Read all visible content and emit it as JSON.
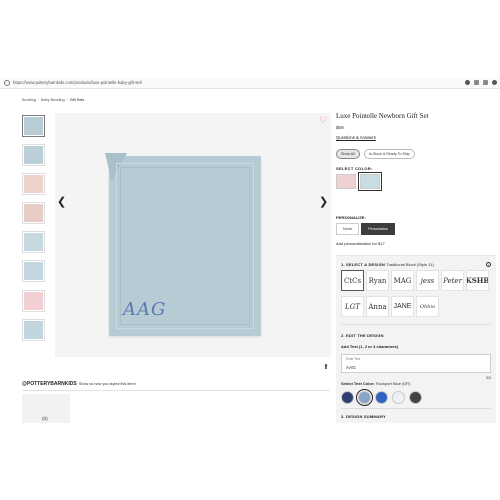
{
  "browser": {
    "url": "https://www.potterybarnkids.com/products/luxe-pointelle-baby-gift-set/"
  },
  "breadcrumb": [
    "Bedding",
    "Baby Bedding",
    "Gift Sets"
  ],
  "product": {
    "title": "Luxe Pointelle Newborn Gift Set",
    "price": "$69",
    "qa_link": "Questions & Answers",
    "filters": [
      "Show All",
      "In-Stock & Ready To Ship"
    ],
    "select_color_label": "SELECT COLOR:",
    "colors": [
      "#f0d1d1",
      "#c9dbe3"
    ],
    "personalize_label": "PERSONALIZE:",
    "personalize_options": [
      "None",
      "Personalize"
    ],
    "add_personalization": "Add personalization for $17",
    "monogram": "AAG"
  },
  "design": {
    "step1": "1. SELECT A DESIGN",
    "step1_selected": "Traditional Block (Style 11)",
    "styles": [
      "CtCs",
      "Ryan",
      "MAG",
      "jess",
      "Peter",
      "KSHB",
      "LGT",
      "Anna",
      "JANE",
      "Ohhio"
    ],
    "step2": "2. EDIT THE DESIGN",
    "add_text": "Add Text (1, 2 or 3 characters)",
    "field_label": "Enter Text",
    "field_value": "AAG",
    "counter": "3/3",
    "text_color_label": "Select Text Color:",
    "text_color_name": "Rockport Blue (DR)",
    "thread_colors": [
      "#2d3f6e",
      "#8aa4c8",
      "#2f62c2",
      "#eef1f3",
      "#444444"
    ],
    "step3": "3. DESIGN SUMMARY"
  },
  "instagram": {
    "handle": "@POTTERYBARNKIDS",
    "tagline": "Show us how you styled this item!",
    "count": "(0)"
  },
  "thumbnails": [
    "#b8ccd6",
    "#bccfd9",
    "#eed3cd",
    "#e7cdc5",
    "#c6d8e0",
    "#c3d6df",
    "#f2cfd3",
    "#c1d5df"
  ]
}
